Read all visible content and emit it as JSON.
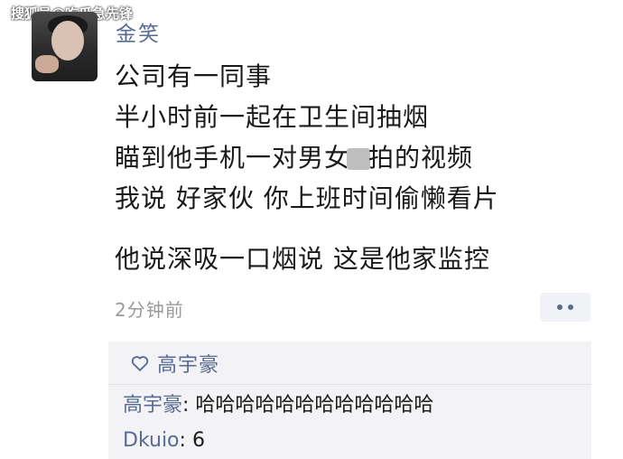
{
  "watermark_top": "搜狐号@吃瓜急先锋",
  "post": {
    "username": "金笑",
    "lines": [
      "公司有一同事",
      "半小时前一起在卫生间抽烟",
      "瞄到他手机一对男女",
      "拍的视频",
      "我说 好家伙 你上班时间偷懒看片",
      "他说深吸一口烟说 这是他家监控"
    ],
    "timestamp": "2分钟前"
  },
  "likes": {
    "names": "高宇豪"
  },
  "comments": [
    {
      "name": "高宇豪",
      "separator": ": ",
      "text": "哈哈哈哈哈哈哈哈哈哈哈哈"
    },
    {
      "name": "Dkuio",
      "separator": ": ",
      "text": "6"
    }
  ],
  "colors": {
    "link": "#576b95",
    "text": "#1a1a1a",
    "muted": "#9a9a9a",
    "comment_bg": "#f3f3f5"
  },
  "icons": {
    "heart": "heart-outline-icon",
    "more": "more-dots-icon"
  }
}
